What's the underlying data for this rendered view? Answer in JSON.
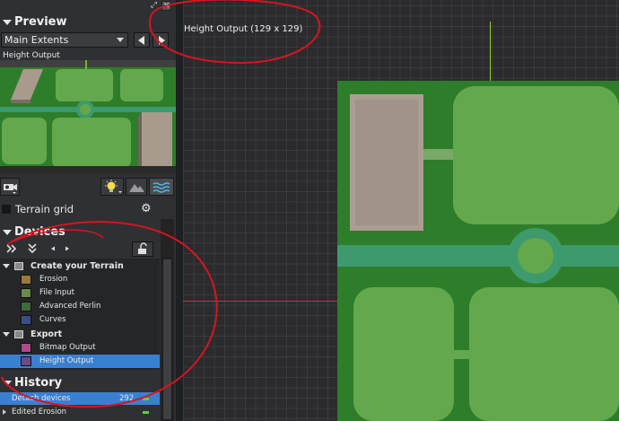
{
  "preview": {
    "title": "Preview",
    "extents_value": "Main Extents",
    "view_label": "Height Output"
  },
  "terrain_grid": {
    "label": "Terrain grid"
  },
  "devices": {
    "title": "Devices",
    "groups": [
      {
        "label": "Create your Terrain",
        "items": [
          {
            "label": "Erosion",
            "icon": "erosion-icon",
            "color": "#9a7a3a"
          },
          {
            "label": "File Input",
            "icon": "file-input-icon",
            "color": "#6a8a4a"
          },
          {
            "label": "Advanced Perlin",
            "icon": "perlin-icon",
            "color": "#3f6b3a"
          },
          {
            "label": "Curves",
            "icon": "curves-icon",
            "color": "#3a4f8a"
          }
        ]
      },
      {
        "label": "Export",
        "items": [
          {
            "label": "Bitmap Output",
            "icon": "bitmap-output-icon",
            "color": "#b04a8a"
          },
          {
            "label": "Height Output",
            "icon": "height-output-icon",
            "color": "#6a4a8a",
            "selected": true
          }
        ]
      }
    ]
  },
  "history": {
    "title": "History",
    "items": [
      {
        "label": "Detach devices",
        "count": "292",
        "selected": true
      },
      {
        "label": "Edited Erosion",
        "count": ""
      }
    ]
  },
  "viewport": {
    "title": "Height Output (129 x 129)"
  },
  "colors": {
    "selection": "#3a80d2",
    "accent_green": "#8ed22c",
    "guide_red": "#b03a52",
    "annotation_red": "#d8141e",
    "terrain_dark": "#2e7d2a",
    "terrain_light": "#63a84c",
    "road": "#3d9a6c",
    "building": "#a89a8c"
  }
}
